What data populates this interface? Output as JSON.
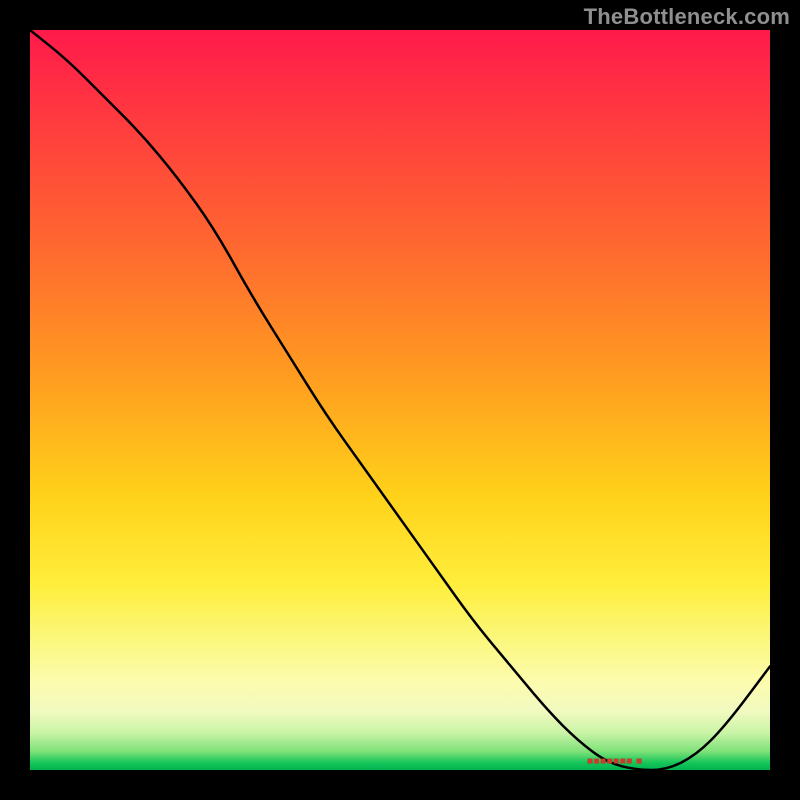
{
  "attribution": "TheBottleneck.com",
  "colors": {
    "page_bg": "#000000",
    "attribution_text": "#8f8f8f",
    "curve": "#000000",
    "tick_label": "#cf3a2a"
  },
  "chart_data": {
    "type": "line",
    "title": "",
    "xlabel": "",
    "ylabel": "",
    "xlim": [
      0,
      100
    ],
    "ylim": [
      0,
      100
    ],
    "grid": false,
    "legend": false,
    "background": "heatmap-gradient",
    "gradient_stops": [
      {
        "pos": 0.0,
        "color": "#ff1a4b"
      },
      {
        "pos": 0.12,
        "color": "#ff3a3f"
      },
      {
        "pos": 0.3,
        "color": "#ff6a2f"
      },
      {
        "pos": 0.48,
        "color": "#ffa01f"
      },
      {
        "pos": 0.63,
        "color": "#ffd21a"
      },
      {
        "pos": 0.75,
        "color": "#ffee3c"
      },
      {
        "pos": 0.82,
        "color": "#fbf77a"
      },
      {
        "pos": 0.88,
        "color": "#fdfcae"
      },
      {
        "pos": 0.92,
        "color": "#f2fac0"
      },
      {
        "pos": 0.95,
        "color": "#c9f4a6"
      },
      {
        "pos": 0.975,
        "color": "#7ee178"
      },
      {
        "pos": 0.99,
        "color": "#16c65a"
      },
      {
        "pos": 1.0,
        "color": "#00b351"
      }
    ],
    "series": [
      {
        "name": "bottleneck-curve",
        "x": [
          0,
          5,
          10,
          15,
          20,
          25,
          30,
          35,
          40,
          45,
          50,
          55,
          60,
          65,
          70,
          74,
          78,
          82,
          86,
          90,
          94,
          100
        ],
        "y": [
          100,
          96,
          91,
          86,
          80,
          73,
          64,
          56,
          48,
          41,
          34,
          27,
          20,
          14,
          8,
          4,
          1,
          0,
          0,
          2,
          6,
          14
        ]
      }
    ],
    "x_tick_label": "■■■■■■■ ■",
    "x_tick_at_x": 80
  }
}
